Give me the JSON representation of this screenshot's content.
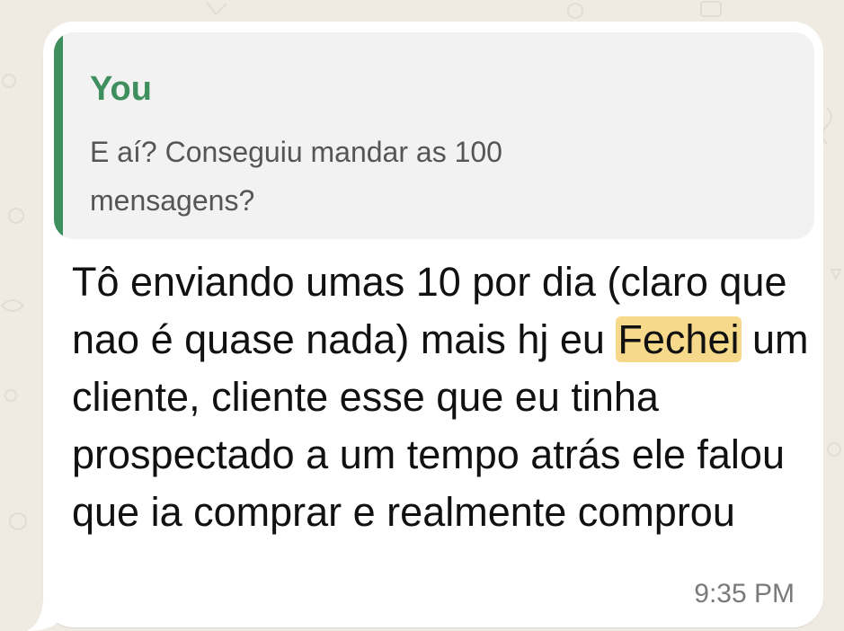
{
  "colors": {
    "background": "#efeae2",
    "bubble": "#ffffff",
    "quote_background": "#f3f2f2",
    "quote_accent": "#3f8f5e",
    "highlight": "#f7d98b"
  },
  "message": {
    "quoted": {
      "author": "You",
      "text": "E aí? Conseguiu mandar as 100 mensagens?"
    },
    "text_before": "Tô enviando umas 10 por dia (claro que nao é quase nada) mais hj eu ",
    "highlighted_word": "Fechei",
    "text_after": " um cliente, cliente esse que eu tinha prospectado a um tempo atrás ele falou que ia comprar e realmente comprou",
    "timestamp": "9:35 PM"
  }
}
